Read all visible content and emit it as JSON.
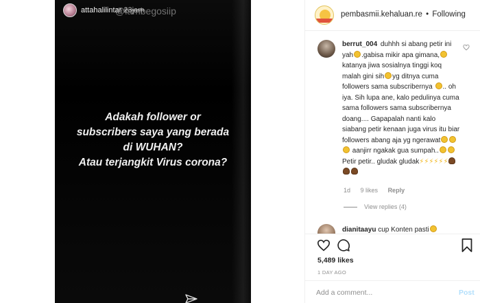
{
  "story": {
    "username": "attahalilintar",
    "time": "23jam",
    "watermark": "@lambegosiip",
    "text_lines": [
      "Adakah follower or",
      "subscribers saya yang berada",
      "di WUHAN?",
      "Atau terjangkit Virus corona?"
    ],
    "send_icon": "paper-plane-icon"
  },
  "header": {
    "username": "pembasmii.kehaluan.re",
    "dot": "•",
    "follow_status": "Following"
  },
  "comment": {
    "username": "berrut_004",
    "parts": {
      "p1": "duhhh si abang petir ini yah",
      "p2": ".gabisa mikir apa gimana,",
      "p3": "katanya jiwa sosialnya tinggi koq malah gini sih",
      "p4": "yg ditnya cuma followers sama subscribernya",
      "p5": ".. oh iya. Sih lupa ane, kalo pedulinya cuma sama followers sama subscribernya doang.... Gapapalah nanti kalo siabang petir kenaan juga virus itu biar followers abang aja yg ngerawat",
      "p6": " aanjirr ngakak gua sumpah..",
      "p7": " Petir petir.. gludak gludak"
    },
    "age": "1d",
    "likes": "9 likes",
    "reply": "Reply",
    "view_replies": "View replies (4)"
  },
  "comment2": {
    "username": "dianitaayu",
    "text": "cup Konten pasti"
  },
  "actions": {
    "heart_icon": "heart-outline-icon",
    "comment_icon": "comment-bubble-icon",
    "bookmark_icon": "bookmark-icon",
    "likes": "5,489 likes",
    "date": "1 DAY AGO"
  },
  "add_comment": {
    "placeholder": "Add a comment...",
    "post_label": "Post"
  }
}
